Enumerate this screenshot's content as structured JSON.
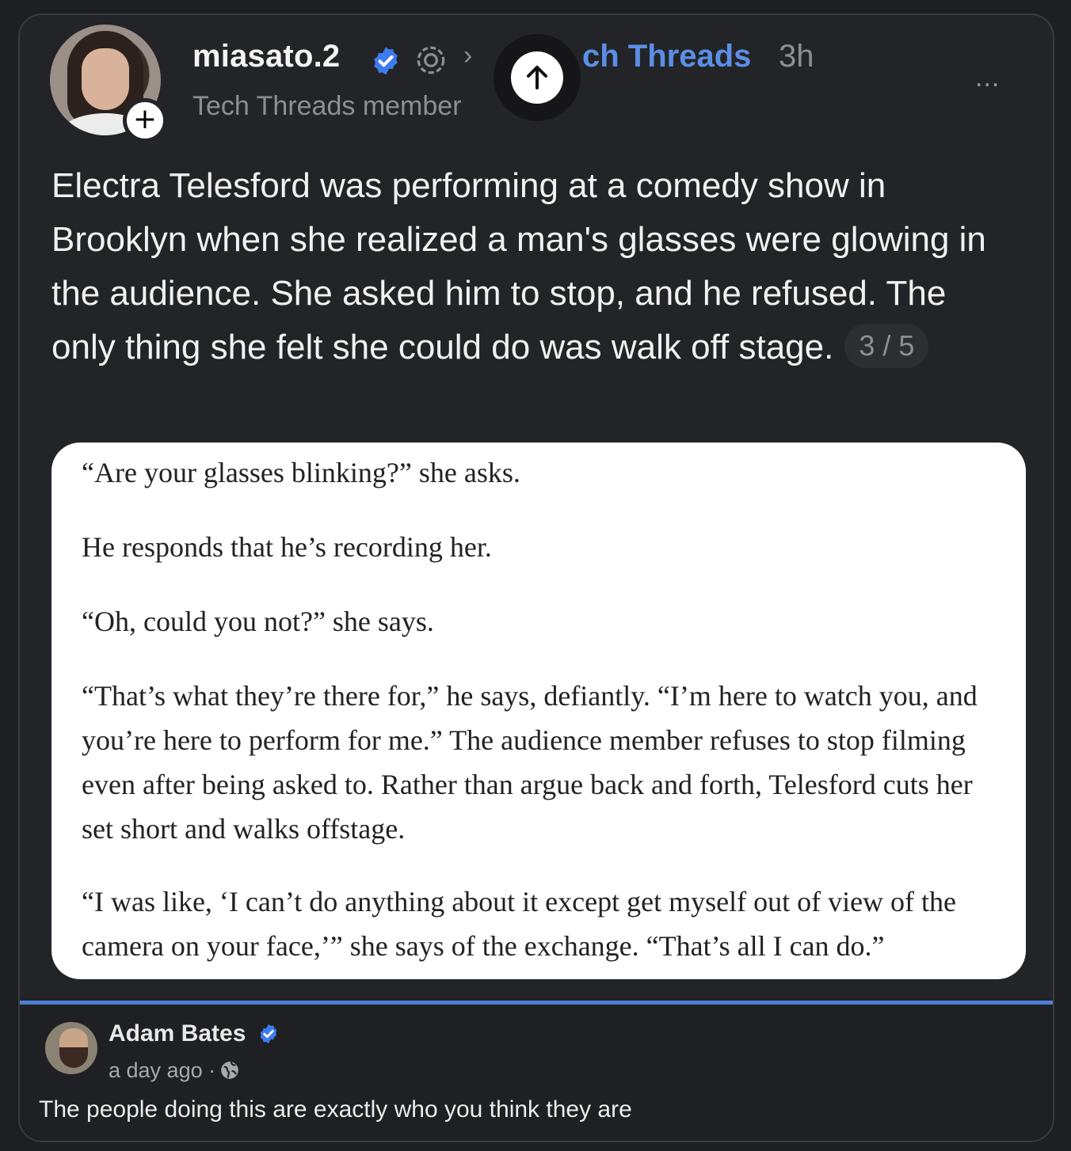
{
  "post": {
    "username": "miasato.2",
    "member_label": "Tech Threads member",
    "community_prefix": "ch Threads",
    "time_ago": "3h",
    "more_label": "...",
    "follow_symbol": "+",
    "chevron_symbol": "›",
    "body": "Electra Telesford was performing at a comedy show in Brooklyn when she realized a man's glasses were glowing in the audience. She asked him to stop, and he refused. The only thing she felt she could do was walk off stage.",
    "page_counter": "3 / 5"
  },
  "article": {
    "paragraphs": [
      "“Are your glasses blinking?” she asks.",
      "He responds that he’s recording her.",
      "“Oh, could you not?” she says.",
      "“That’s what they’re there for,” he says, defiantly. “I’m here to watch you, and you’re here to perform for me.” The audience member refuses to stop filming even after being asked to. Rather than argue back and forth, Telesford cuts her set short and walks offstage.",
      "“I was like, ‘I can’t do anything about it except get myself out of view of the camera on your face,’” she says of the exchange. “That’s all I can do.”"
    ]
  },
  "comment": {
    "author": "Adam Bates",
    "time": "a day ago ·",
    "text": "The people doing this are exactly who you think they are"
  },
  "colors": {
    "background": "#1e1f22",
    "card": "#232427",
    "accent_blue": "#5b8fe6",
    "verified_blue": "#3d7cf0",
    "divider_blue": "#4d7fd6",
    "muted_text": "#8e8f93"
  },
  "icons": [
    "follow-plus-icon",
    "verified-badge-icon",
    "threads-community-icon",
    "chevron-right-icon",
    "arrow-up-icon",
    "more-options-icon",
    "globe-icon"
  ]
}
